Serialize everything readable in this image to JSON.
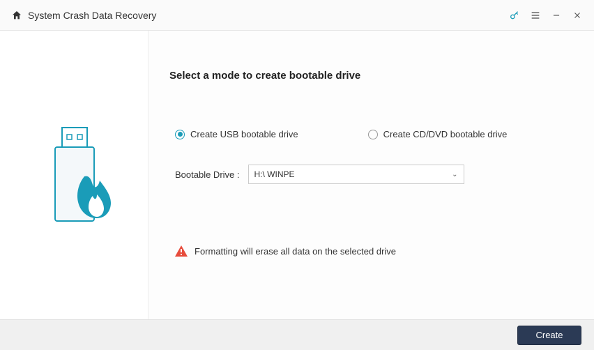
{
  "header": {
    "title": "System Crash Data Recovery"
  },
  "main": {
    "title": "Select a mode to create bootable drive",
    "radio_usb": "Create USB bootable drive",
    "radio_cd": "Create CD/DVD bootable drive",
    "drive_label": "Bootable Drive :",
    "drive_value": "H:\\ WINPE",
    "warning": "Formatting will erase all data on the selected drive"
  },
  "footer": {
    "create": "Create"
  }
}
